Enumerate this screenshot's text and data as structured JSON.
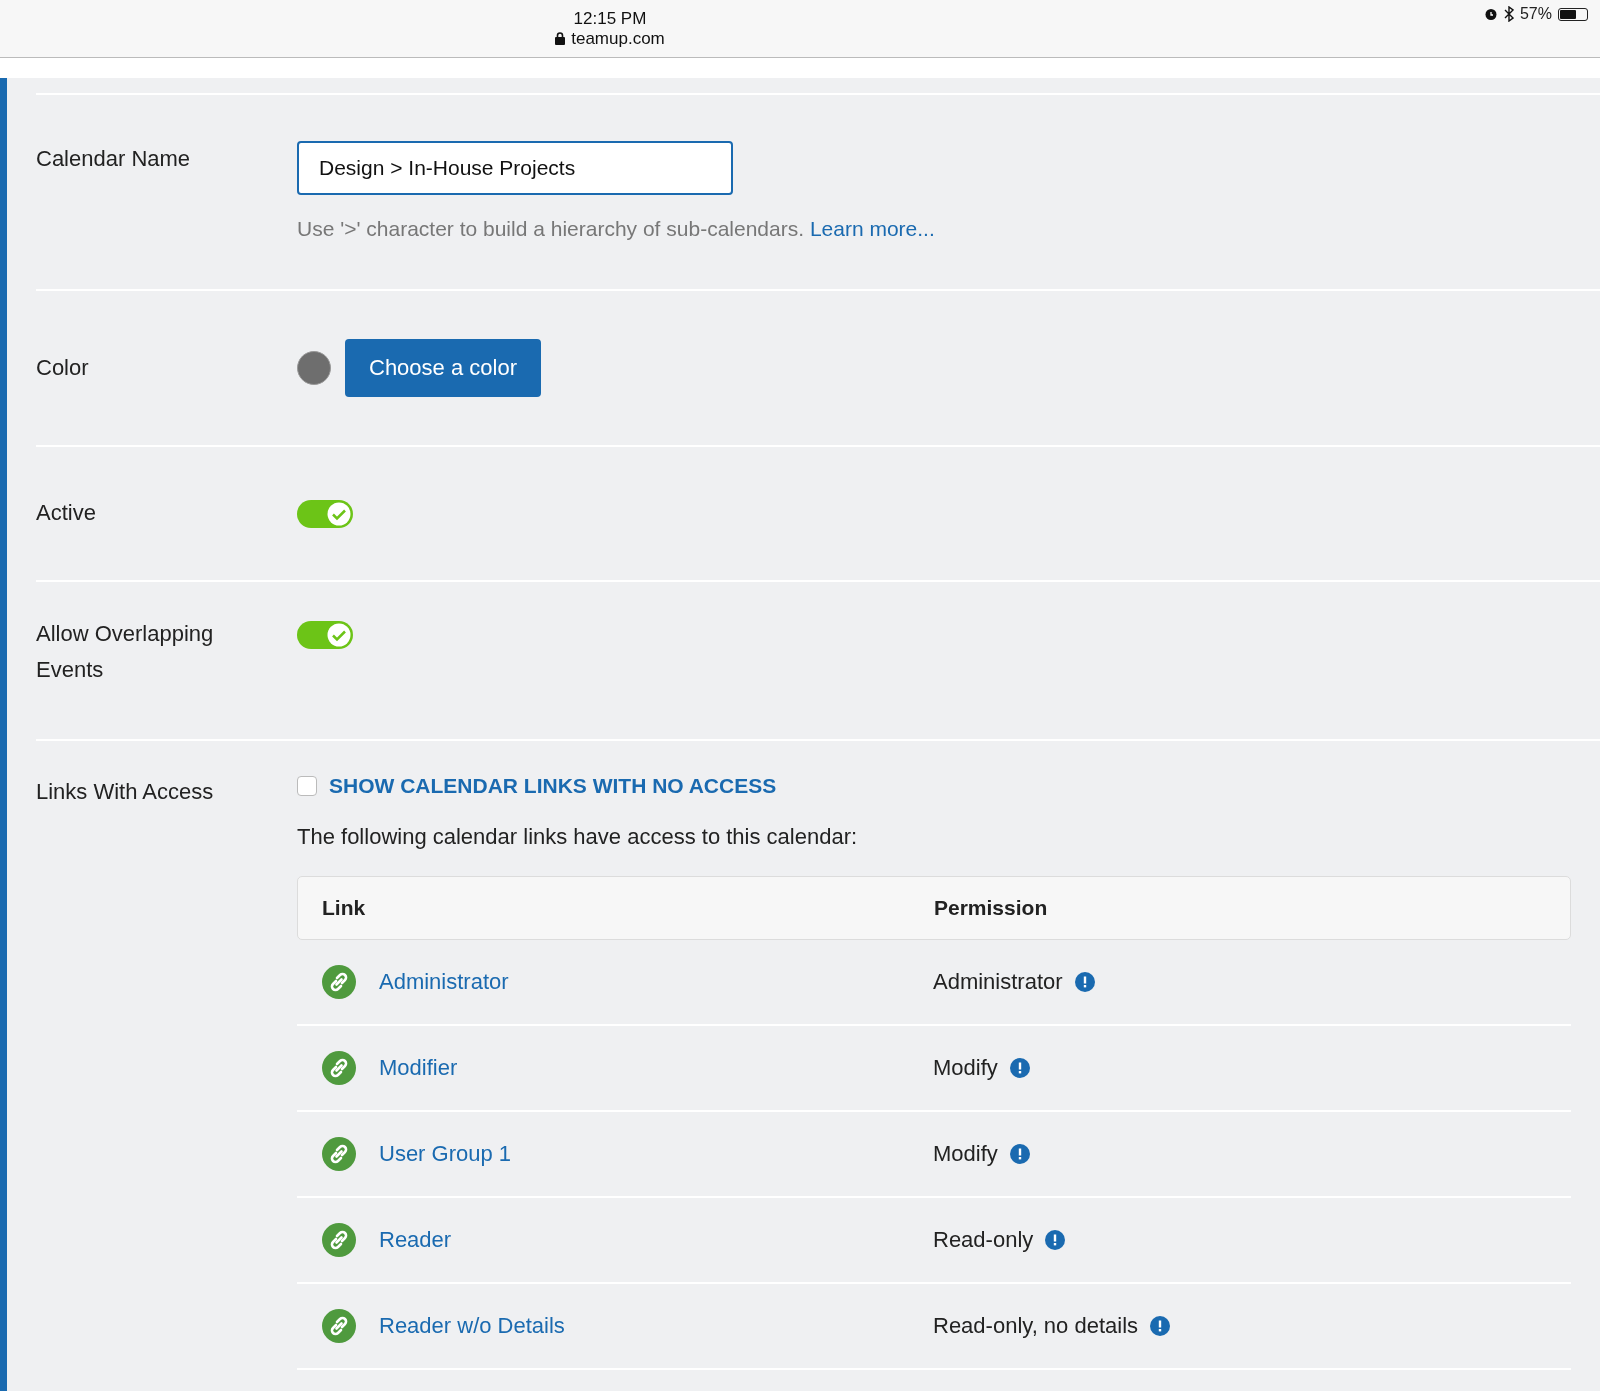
{
  "status_bar": {
    "time": "12:15 PM",
    "url": "teamup.com",
    "battery": "57%"
  },
  "sections": [
    {
      "kind": "text_field",
      "label": "Calendar Name",
      "value": "Design > In-House Projects",
      "hint": "Use '>' character to build a hierarchy of sub-calendars.",
      "hint_link": "Learn more..."
    },
    {
      "kind": "color",
      "label": "Color",
      "color": "#6e6e6e",
      "button": "Choose a color"
    },
    {
      "kind": "toggle",
      "label": "Active",
      "on": true
    },
    {
      "kind": "toggle",
      "label": "Allow Overlapping Events",
      "on": true
    },
    {
      "kind": "links",
      "label": "Links With Access",
      "checkbox": {
        "label": "SHOW CALENDAR LINKS WITH NO ACCESS",
        "checked": false
      },
      "intro": "The following calendar links have access to this calendar:",
      "table": {
        "columns": [
          "Link",
          "Permission"
        ],
        "rows": [
          {
            "link": "Administrator",
            "permission": "Administrator"
          },
          {
            "link": "Modifier",
            "permission": "Modify"
          },
          {
            "link": "User Group 1",
            "permission": "Modify"
          },
          {
            "link": "Reader",
            "permission": "Read-only"
          },
          {
            "link": "Reader w/o Details",
            "permission": "Read-only, no details"
          }
        ]
      }
    }
  ]
}
